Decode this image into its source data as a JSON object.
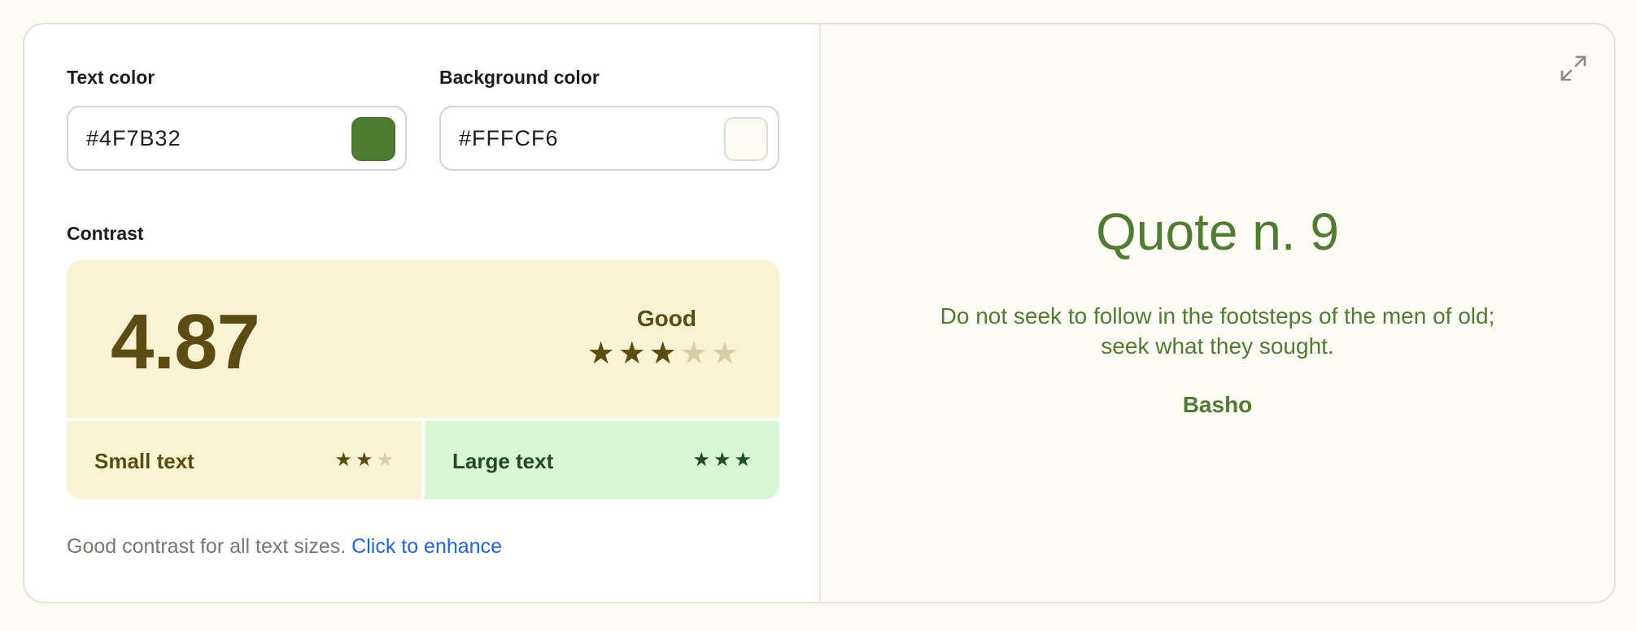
{
  "inputs": {
    "text_color": {
      "label": "Text color",
      "value": "#4F7B32",
      "swatch": "#4F7B32"
    },
    "background_color": {
      "label": "Background color",
      "value": "#FFFCF6",
      "swatch": "#FFFCF6"
    }
  },
  "contrast": {
    "label": "Contrast",
    "score": "4.87",
    "rating": "Good",
    "stars": {
      "filled": 3,
      "total": 5
    },
    "small_text": {
      "label": "Small text",
      "stars_filled": 2,
      "stars_total": 3
    },
    "large_text": {
      "label": "Large text",
      "stars_filled": 3,
      "stars_total": 3
    },
    "note": "Good contrast for all text sizes.",
    "enhance_link": "Click to enhance"
  },
  "preview": {
    "expand_icon": "expand-icon",
    "title": "Quote n. 9",
    "quote_line1": "Do not seek to follow in the footsteps of the men of old;",
    "quote_line2": "seek what they sought.",
    "author": "Basho"
  },
  "colors": {
    "text": "#4F7B32",
    "background": "#FFFCF6",
    "good_bg": "#FAF3D3",
    "great_bg": "#D8F7D5",
    "link": "#2364D6"
  }
}
